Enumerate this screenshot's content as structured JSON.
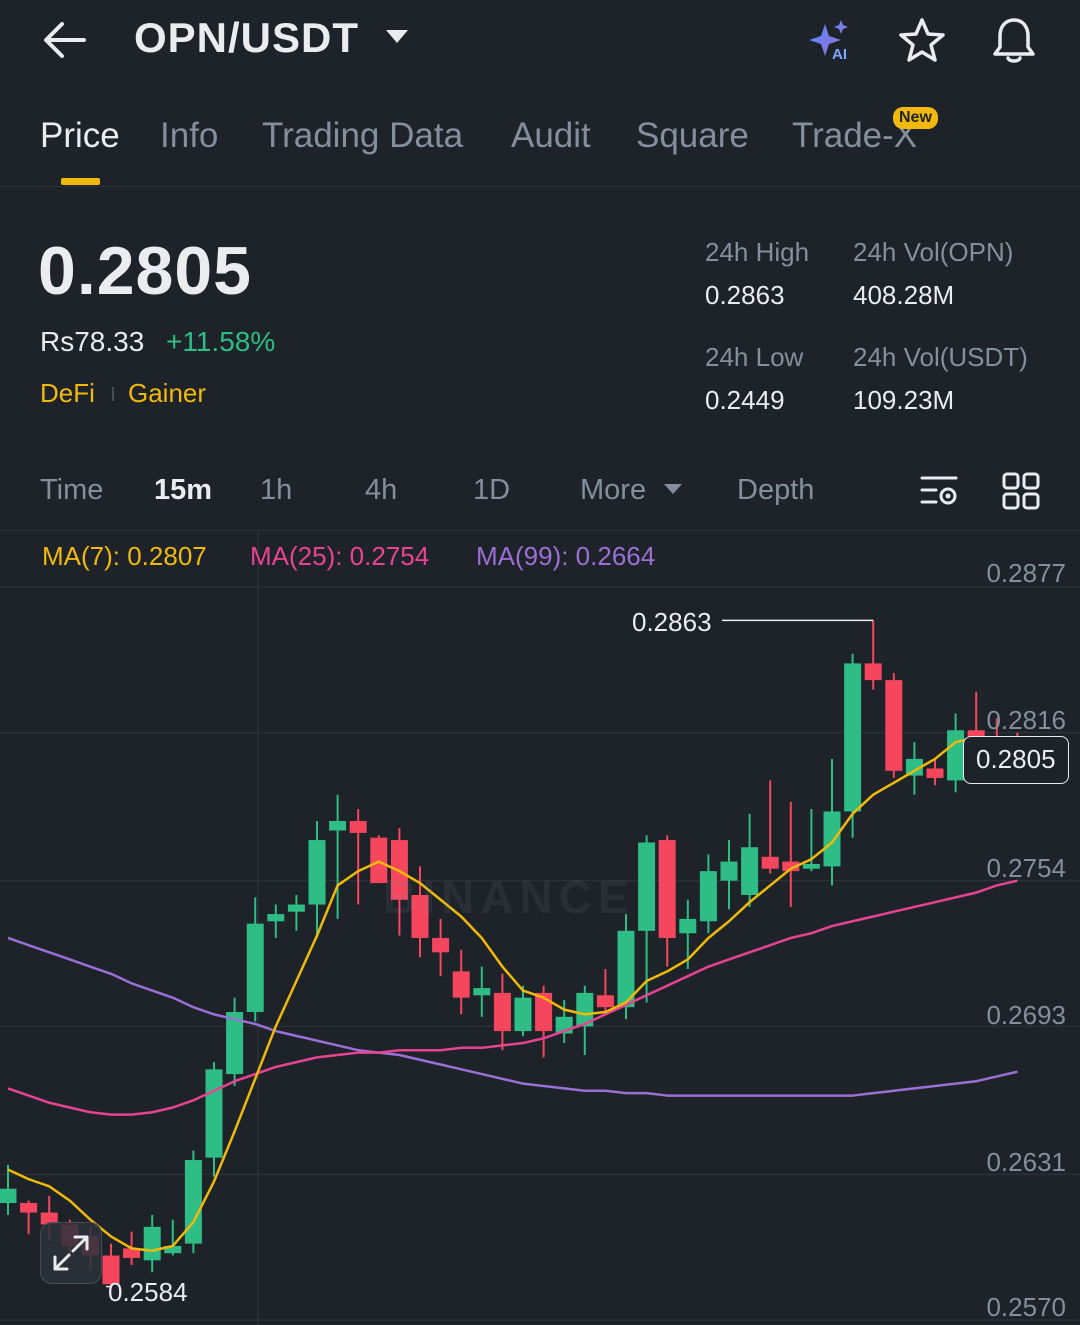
{
  "header": {
    "pair": "OPN/USDT"
  },
  "tabs": [
    {
      "label": "Price"
    },
    {
      "label": "Info"
    },
    {
      "label": "Trading Data"
    },
    {
      "label": "Audit"
    },
    {
      "label": "Square"
    },
    {
      "label": "Trade-X"
    }
  ],
  "new_badge": "New",
  "ticker": {
    "last_price": "0.2805",
    "fiat_price": "Rs78.33",
    "change_pct": "+11.58%",
    "tags": [
      "DeFi",
      "Gainer"
    ],
    "high_label": "24h High",
    "high": "0.2863",
    "low_label": "24h Low",
    "low": "0.2449",
    "vol_base_label": "24h Vol(OPN)",
    "vol_base": "408.28M",
    "vol_quote_label": "24h Vol(USDT)",
    "vol_quote": "109.23M"
  },
  "intervals": {
    "time": "Time",
    "options": [
      "15m",
      "1h",
      "4h",
      "1D"
    ],
    "selected": "15m",
    "more": "More",
    "depth": "Depth"
  },
  "indicators": {
    "ma7": "MA(7): 0.2807",
    "ma25": "MA(25): 0.2754",
    "ma99": "MA(99): 0.2664"
  },
  "colors": {
    "background": "#1e2329",
    "up": "#2ebd85",
    "down": "#f6465d",
    "accent": "#f0b90b",
    "ma7": "#f0b90b",
    "ma25": "#e84393",
    "ma99": "#9b6fd6"
  },
  "chart_data": {
    "type": "candlestick",
    "y_ticks": [
      "0.2877",
      "0.2816",
      "0.2754",
      "0.2693",
      "0.2631",
      "0.2570"
    ],
    "ylim": [
      0.257,
      0.2877
    ],
    "current_price": "0.2805",
    "high_marker": "0.2863",
    "low_marker": "0.2584",
    "watermark": "BINANCE",
    "candles": [
      [
        0.2619,
        0.2625,
        0.2635,
        0.2614
      ],
      [
        0.2619,
        0.2615,
        0.262,
        0.2606
      ],
      [
        0.2615,
        0.261,
        0.2622,
        0.2603
      ],
      [
        0.261,
        0.2601,
        0.2612,
        0.2596
      ],
      [
        0.2605,
        0.2597,
        0.2609,
        0.2591
      ],
      [
        0.2597,
        0.2585,
        0.2602,
        0.2584
      ],
      [
        0.26,
        0.2596,
        0.2607,
        0.2593
      ],
      [
        0.2595,
        0.2609,
        0.2614,
        0.259
      ],
      [
        0.2598,
        0.2601,
        0.2612,
        0.2597
      ],
      [
        0.2602,
        0.2637,
        0.2641,
        0.2598
      ],
      [
        0.2638,
        0.2675,
        0.2678,
        0.263
      ],
      [
        0.2673,
        0.2699,
        0.2705,
        0.2668
      ],
      [
        0.2699,
        0.2736,
        0.2747,
        0.2695
      ],
      [
        0.2737,
        0.274,
        0.2744,
        0.273
      ],
      [
        0.2741,
        0.2744,
        0.2748,
        0.2733
      ],
      [
        0.2744,
        0.2771,
        0.2779,
        0.273
      ],
      [
        0.2775,
        0.2779,
        0.279,
        0.2738
      ],
      [
        0.2779,
        0.2774,
        0.2784,
        0.2744
      ],
      [
        0.2772,
        0.2753,
        0.2773,
        0.2753
      ],
      [
        0.2771,
        0.2746,
        0.2776,
        0.2731
      ],
      [
        0.2748,
        0.273,
        0.276,
        0.2722
      ],
      [
        0.273,
        0.2724,
        0.2738,
        0.2714
      ],
      [
        0.2716,
        0.2705,
        0.2725,
        0.2698
      ],
      [
        0.2706,
        0.2709,
        0.2718,
        0.2697
      ],
      [
        0.2707,
        0.2691,
        0.2715,
        0.2683
      ],
      [
        0.2691,
        0.2705,
        0.271,
        0.2689
      ],
      [
        0.2707,
        0.2691,
        0.271,
        0.268
      ],
      [
        0.269,
        0.2697,
        0.2704,
        0.2686
      ],
      [
        0.2693,
        0.2707,
        0.271,
        0.2681
      ],
      [
        0.2706,
        0.2701,
        0.2717,
        0.2698
      ],
      [
        0.2701,
        0.2733,
        0.274,
        0.2696
      ],
      [
        0.2733,
        0.277,
        0.2773,
        0.2703
      ],
      [
        0.2771,
        0.273,
        0.2773,
        0.2718
      ],
      [
        0.2732,
        0.2738,
        0.2746,
        0.2717
      ],
      [
        0.2737,
        0.2758,
        0.2765,
        0.2732
      ],
      [
        0.2754,
        0.2762,
        0.2771,
        0.2742
      ],
      [
        0.2748,
        0.2768,
        0.2782,
        0.2743
      ],
      [
        0.2764,
        0.2759,
        0.2796,
        0.2757
      ],
      [
        0.2762,
        0.2758,
        0.2787,
        0.2743
      ],
      [
        0.2759,
        0.2761,
        0.2784,
        0.2758
      ],
      [
        0.276,
        0.2783,
        0.2805,
        0.2752
      ],
      [
        0.2783,
        0.2845,
        0.2849,
        0.2772
      ],
      [
        0.2845,
        0.2838,
        0.2863,
        0.2834
      ],
      [
        0.2838,
        0.28,
        0.2841,
        0.2797
      ],
      [
        0.2798,
        0.2805,
        0.2812,
        0.279
      ],
      [
        0.2801,
        0.2797,
        0.2805,
        0.2794
      ],
      [
        0.2796,
        0.2817,
        0.2824,
        0.2791
      ],
      [
        0.2817,
        0.2813,
        0.2833,
        0.2804
      ],
      [
        0.2814,
        0.2807,
        0.2822,
        0.2802
      ],
      [
        0.2808,
        0.2805,
        0.2816,
        0.2803
      ]
    ],
    "ma7": [
      0.2633,
      0.2629,
      0.2626,
      0.262,
      0.2612,
      0.2605,
      0.26,
      0.2599,
      0.2601,
      0.2611,
      0.2628,
      0.2649,
      0.2671,
      0.2693,
      0.2712,
      0.2731,
      0.2752,
      0.2758,
      0.2762,
      0.2758,
      0.2753,
      0.2746,
      0.2739,
      0.273,
      0.2718,
      0.2708,
      0.2705,
      0.27,
      0.2698,
      0.2699,
      0.2703,
      0.2712,
      0.2716,
      0.2721,
      0.273,
      0.2737,
      0.2745,
      0.2752,
      0.2759,
      0.2763,
      0.277,
      0.2782,
      0.279,
      0.2795,
      0.28,
      0.2805,
      0.2812,
      0.2814,
      0.2809,
      0.2806
    ],
    "ma25": [
      0.2667,
      0.2664,
      0.2661,
      0.2659,
      0.2657,
      0.2656,
      0.2656,
      0.2657,
      0.2659,
      0.2662,
      0.2666,
      0.267,
      0.2673,
      0.2676,
      0.2678,
      0.268,
      0.2681,
      0.2682,
      0.2682,
      0.2683,
      0.2683,
      0.2683,
      0.2684,
      0.2684,
      0.2685,
      0.2686,
      0.2688,
      0.2691,
      0.2694,
      0.2698,
      0.2702,
      0.2706,
      0.271,
      0.2714,
      0.2718,
      0.2721,
      0.2724,
      0.2727,
      0.273,
      0.2732,
      0.2735,
      0.2737,
      0.2739,
      0.2741,
      0.2743,
      0.2745,
      0.2747,
      0.2749,
      0.2752,
      0.2754
    ],
    "ma99": [
      0.273,
      0.2727,
      0.2724,
      0.2721,
      0.2718,
      0.2715,
      0.2711,
      0.2708,
      0.2705,
      0.2701,
      0.2698,
      0.2696,
      0.2694,
      0.2691,
      0.2689,
      0.2687,
      0.2685,
      0.2683,
      0.2682,
      0.2681,
      0.2679,
      0.2677,
      0.2675,
      0.2673,
      0.2671,
      0.2669,
      0.2668,
      0.2667,
      0.2666,
      0.2666,
      0.2665,
      0.2665,
      0.2664,
      0.2664,
      0.2664,
      0.2664,
      0.2664,
      0.2664,
      0.2664,
      0.2664,
      0.2664,
      0.2664,
      0.2665,
      0.2666,
      0.2667,
      0.2668,
      0.2669,
      0.267,
      0.2672,
      0.2674
    ]
  }
}
